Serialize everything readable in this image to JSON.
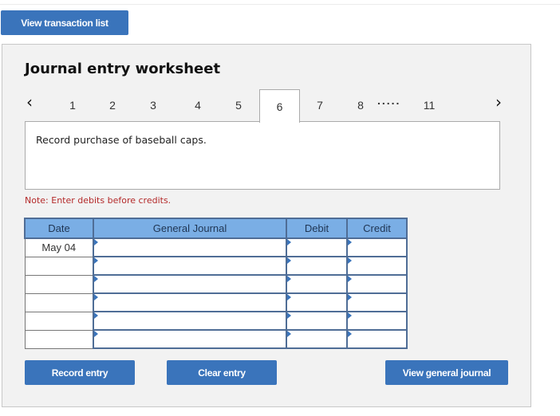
{
  "top_button": "View transaction list",
  "worksheet": {
    "title": "Journal entry worksheet",
    "prev_icon": "chevron-left-icon",
    "next_icon": "chevron-right-icon",
    "tabs": [
      "1",
      "2",
      "3",
      "4",
      "5",
      "6",
      "7",
      "8",
      "11"
    ],
    "active_tab": "6",
    "ellipsis": ".....",
    "description": "Record purchase of baseball caps.",
    "note": "Note: Enter debits before credits."
  },
  "table": {
    "headers": [
      "Date",
      "General Journal",
      "Debit",
      "Credit"
    ],
    "rows": [
      {
        "date": "May 04",
        "account": "",
        "debit": "",
        "credit": ""
      },
      {
        "date": "",
        "account": "",
        "debit": "",
        "credit": ""
      },
      {
        "date": "",
        "account": "",
        "debit": "",
        "credit": ""
      },
      {
        "date": "",
        "account": "",
        "debit": "",
        "credit": ""
      },
      {
        "date": "",
        "account": "",
        "debit": "",
        "credit": ""
      },
      {
        "date": "",
        "account": "",
        "debit": "",
        "credit": ""
      }
    ]
  },
  "buttons": {
    "record": "Record entry",
    "clear": "Clear entry",
    "view_journal": "View general journal"
  }
}
